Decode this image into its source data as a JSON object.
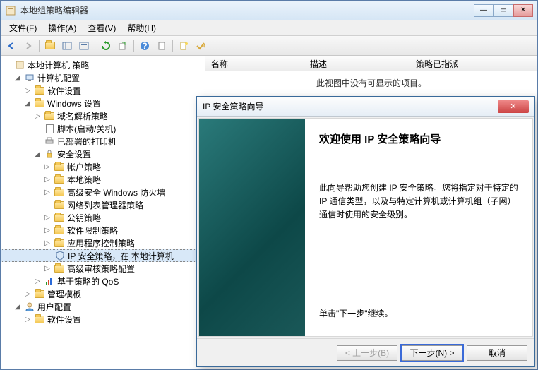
{
  "window": {
    "title": "本地组策略编辑器",
    "controls": {
      "min": "—",
      "max": "▭",
      "close": "✕"
    }
  },
  "menubar": [
    {
      "label": "文件(F)"
    },
    {
      "label": "操作(A)"
    },
    {
      "label": "查看(V)"
    },
    {
      "label": "帮助(H)"
    }
  ],
  "tree": {
    "root": "本地计算机 策略",
    "computer_config": "计算机配置",
    "software_settings": "软件设置",
    "windows_settings": "Windows 设置",
    "name_resolution": "域名解析策略",
    "scripts": "脚本(启动/关机)",
    "deployed_printers": "已部署的打印机",
    "security_settings": "安全设置",
    "account_policy": "帐户策略",
    "local_policy": "本地策略",
    "advanced_firewall": "高级安全 Windows 防火墙",
    "network_list": "网络列表管理器策略",
    "public_key": "公钥策略",
    "software_restriction": "软件限制策略",
    "app_control": "应用程序控制策略",
    "ip_security": "IP 安全策略，在 本地计算机",
    "advanced_audit": "高级审核策略配置",
    "qos": "基于策略的 QoS",
    "admin_templates": "管理模板",
    "user_config": "用户配置",
    "user_software": "软件设置"
  },
  "list": {
    "columns": {
      "name": "名称",
      "desc": "描述",
      "assigned": "策略已指派"
    },
    "empty": "此视图中没有可显示的项目。"
  },
  "wizard": {
    "title": "IP 安全策略向导",
    "heading": "欢迎使用 IP 安全策略向导",
    "para": "此向导帮助您创建 IP 安全策略。您将指定对于特定的 IP 通信类型，以及与特定计算机或计算机组（子网）通信时使用的安全级别。",
    "hint": "单击\"下一步\"继续。",
    "buttons": {
      "back": "< 上一步(B)",
      "next": "下一步(N) >",
      "cancel": "取消"
    }
  }
}
